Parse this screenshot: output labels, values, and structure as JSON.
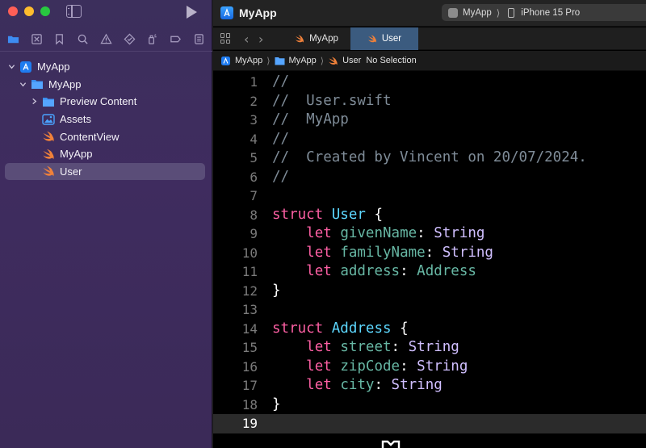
{
  "sidebar": {
    "tree": [
      {
        "label": "MyApp",
        "icon": "app-project-icon",
        "level": 0,
        "expanded": true
      },
      {
        "label": "MyApp",
        "icon": "folder-icon",
        "level": 1,
        "expanded": true
      },
      {
        "label": "Preview Content",
        "icon": "folder-icon",
        "level": 2,
        "expanded": false
      },
      {
        "label": "Assets",
        "icon": "asset-catalog-icon",
        "level": 2
      },
      {
        "label": "ContentView",
        "icon": "swift-file-icon",
        "level": 2
      },
      {
        "label": "MyApp",
        "icon": "swift-file-icon",
        "level": 2
      },
      {
        "label": "User",
        "icon": "swift-file-icon",
        "level": 2,
        "selected": true
      }
    ]
  },
  "titlebar": {
    "project": "MyApp",
    "scheme": "MyApp",
    "scheme_sep": "⟩",
    "device": "iPhone 15 Pro"
  },
  "tabs": [
    {
      "label": "MyApp",
      "active": false
    },
    {
      "label": "User",
      "active": true
    }
  ],
  "breadcrumbs": [
    "MyApp",
    "MyApp",
    "User",
    "No Selection"
  ],
  "breadcrumb_sep": "⟩",
  "editor": {
    "current_line": 19,
    "lines": [
      {
        "n": "1",
        "text": "//"
      },
      {
        "n": "2",
        "text": "//  User.swift"
      },
      {
        "n": "3",
        "text": "//  MyApp"
      },
      {
        "n": "4",
        "text": "//"
      },
      {
        "n": "5",
        "text": "//  Created by Vincent on 20/07/2024."
      },
      {
        "n": "6",
        "text": "//"
      },
      {
        "n": "7",
        "text": ""
      },
      {
        "n": "8",
        "kw": "struct",
        "name": "User",
        "tail": " {"
      },
      {
        "n": "9",
        "kw": "let",
        "prop": "givenName",
        "type": "String",
        "type_kind": "sys"
      },
      {
        "n": "10",
        "kw": "let",
        "prop": "familyName",
        "type": "String",
        "type_kind": "sys"
      },
      {
        "n": "11",
        "kw": "let",
        "prop": "address",
        "type": "Address",
        "type_kind": "user"
      },
      {
        "n": "12",
        "text": "}"
      },
      {
        "n": "13",
        "text": ""
      },
      {
        "n": "14",
        "kw": "struct",
        "name": "Address",
        "tail": " {"
      },
      {
        "n": "15",
        "kw": "let",
        "prop": "street",
        "type": "String",
        "type_kind": "sys"
      },
      {
        "n": "16",
        "kw": "let",
        "prop": "zipCode",
        "type": "String",
        "type_kind": "sys"
      },
      {
        "n": "17",
        "kw": "let",
        "prop": "city",
        "type": "String",
        "type_kind": "sys"
      },
      {
        "n": "18",
        "text": "}"
      },
      {
        "n": "19",
        "text": ""
      }
    ]
  },
  "colors": {
    "keyword": "#fc5fa3",
    "type_decl": "#5dd8ff",
    "property": "#67b7a4",
    "system_type": "#d0bfff",
    "comment": "#7f8c98",
    "active_tab": "#3b5b7f",
    "sidebar_selection": "#5a4d78"
  }
}
